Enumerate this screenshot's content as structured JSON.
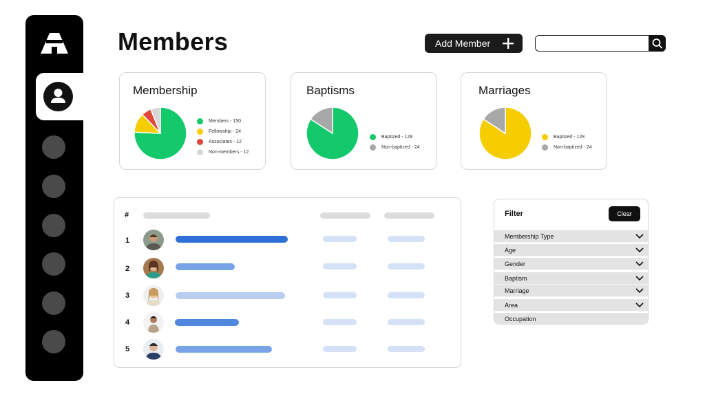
{
  "header": {
    "title": "Members",
    "add_button_label": "Add Member",
    "search_placeholder": ""
  },
  "sidebar": {
    "nav_items": [
      "member",
      "item-2",
      "item-3",
      "item-4",
      "item-5",
      "item-6",
      "item-7"
    ]
  },
  "cards": [
    {
      "title": "Membership",
      "legend": [
        {
          "label": "Members - 150",
          "color": "#13c96b"
        },
        {
          "label": "Fellowship - 24",
          "color": "#f5cd00"
        },
        {
          "label": "Associates - 12",
          "color": "#e0483b"
        },
        {
          "label": "Non-members - 12",
          "color": "#d7d7d7"
        }
      ]
    },
    {
      "title": "Baptisms",
      "legend": [
        {
          "label": "Baptized - 128",
          "color": "#13c96b"
        },
        {
          "label": "Non-baptized - 24",
          "color": "#a8a8a8"
        }
      ]
    },
    {
      "title": "Marriages",
      "legend": [
        {
          "label": "Baptized - 128",
          "color": "#f5cd00"
        },
        {
          "label": "Non-baptized - 24",
          "color": "#a8a8a8"
        }
      ]
    }
  ],
  "chart_data": [
    {
      "type": "pie",
      "title": "Membership",
      "categories": [
        "Members",
        "Fellowship",
        "Associates",
        "Non-members"
      ],
      "values": [
        150,
        24,
        12,
        12
      ]
    },
    {
      "type": "pie",
      "title": "Baptisms",
      "categories": [
        "Baptized",
        "Non-baptized"
      ],
      "values": [
        128,
        24
      ]
    },
    {
      "type": "pie",
      "title": "Marriages",
      "categories": [
        "Baptized",
        "Non-baptized"
      ],
      "values": [
        128,
        24
      ]
    }
  ],
  "table": {
    "header_hash": "#",
    "rows": [
      {
        "num": "1",
        "bar_color": "#2f6fd8"
      },
      {
        "num": "2",
        "bar_color": "#76a2e6"
      },
      {
        "num": "3",
        "bar_color": "#b8cdef"
      },
      {
        "num": "4",
        "bar_color": "#4f86de"
      },
      {
        "num": "5",
        "bar_color": "#79a3e7"
      }
    ]
  },
  "filter": {
    "title": "Filter",
    "clear_label": "Clear",
    "items": [
      "Membership Type",
      "Age",
      "Gender",
      "Baptism",
      "Marriage",
      "Area",
      "Occupation"
    ]
  }
}
